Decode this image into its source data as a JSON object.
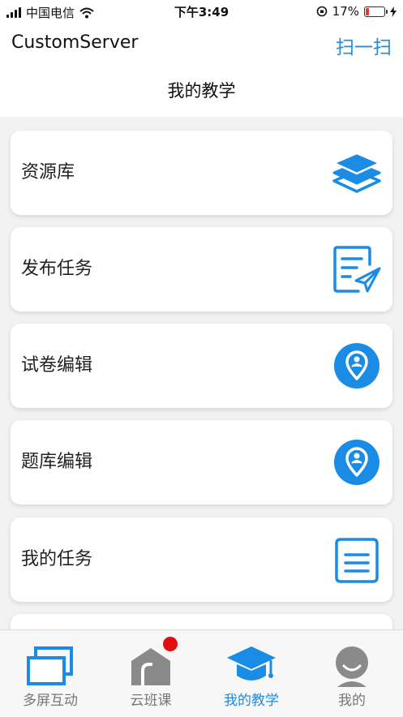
{
  "status_bar": {
    "carrier": "中国电信",
    "time": "下午3:49",
    "battery": "17%",
    "battery_level": 0.17
  },
  "header": {
    "app_name": "CustomServer",
    "scan_label": "扫一扫",
    "title": "我的教学"
  },
  "menu": [
    {
      "label": "资源库",
      "icon": "layers-icon"
    },
    {
      "label": "发布任务",
      "icon": "publish-task-icon"
    },
    {
      "label": "试卷编辑",
      "icon": "location-pin-icon"
    },
    {
      "label": "题库编辑",
      "icon": "location-pin-icon"
    },
    {
      "label": "我的任务",
      "icon": "clipboard-list-icon"
    }
  ],
  "tabs": [
    {
      "label": "多屏互动",
      "icon": "multi-screen-icon",
      "active": false
    },
    {
      "label": "云班课",
      "icon": "cloud-class-icon",
      "active": false,
      "badge": true
    },
    {
      "label": "我的教学",
      "icon": "graduation-cap-icon",
      "active": true
    },
    {
      "label": "我的",
      "icon": "profile-icon",
      "active": false
    }
  ],
  "colors": {
    "accent": "#1a8ce5",
    "inactive": "#8a8a8a",
    "badge": "#e01010",
    "battery_low": "#e53935"
  }
}
